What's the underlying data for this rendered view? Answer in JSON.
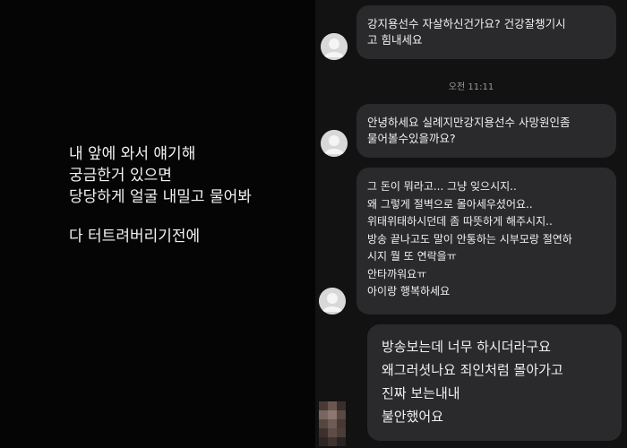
{
  "caption": {
    "lines": [
      "내 앞에 와서 얘기해",
      "궁금한거 있으면",
      "당당하게 얼굴 내밀고 물어봐"
    ],
    "last_line": "다 터트려버리기전에"
  },
  "chat": {
    "timestamp": "오전 11:11",
    "messages": [
      {
        "lines": [
          "강지용선수 자살하신건가요? 건강잘챙기시",
          "고 힘내세요"
        ]
      },
      {
        "lines": [
          "안녕하세요 실례지만강지용선수 사망원인좀",
          "물어볼수있을까요?"
        ]
      },
      {
        "lines": [
          "그 돈이 뭐라고... 그냥 잊으시지..",
          "왜 그렇게 절벽으로 몰아세우셨어요..",
          "위태위태하시던데 좀 따뜻하게 해주시지..",
          "방송 끝나고도 말이 안통하는 시부모랑 절연하",
          "시지 뭘 또 연락을ㅠ",
          "안타까워요ㅠ",
          "아이랑 행복하세요"
        ]
      },
      {
        "lines": [
          "방송보는데 너무 하시더라구요",
          "왜그러셧나요 죄인처럼 몰아가고",
          "진짜 보는내내",
          "불안했어요"
        ]
      }
    ]
  },
  "colors": {
    "left_bg": "#050505",
    "chat_bg": "#121212",
    "bubble_bg": "#2a2a2c",
    "avatar_gray": "#d8d8d8"
  }
}
